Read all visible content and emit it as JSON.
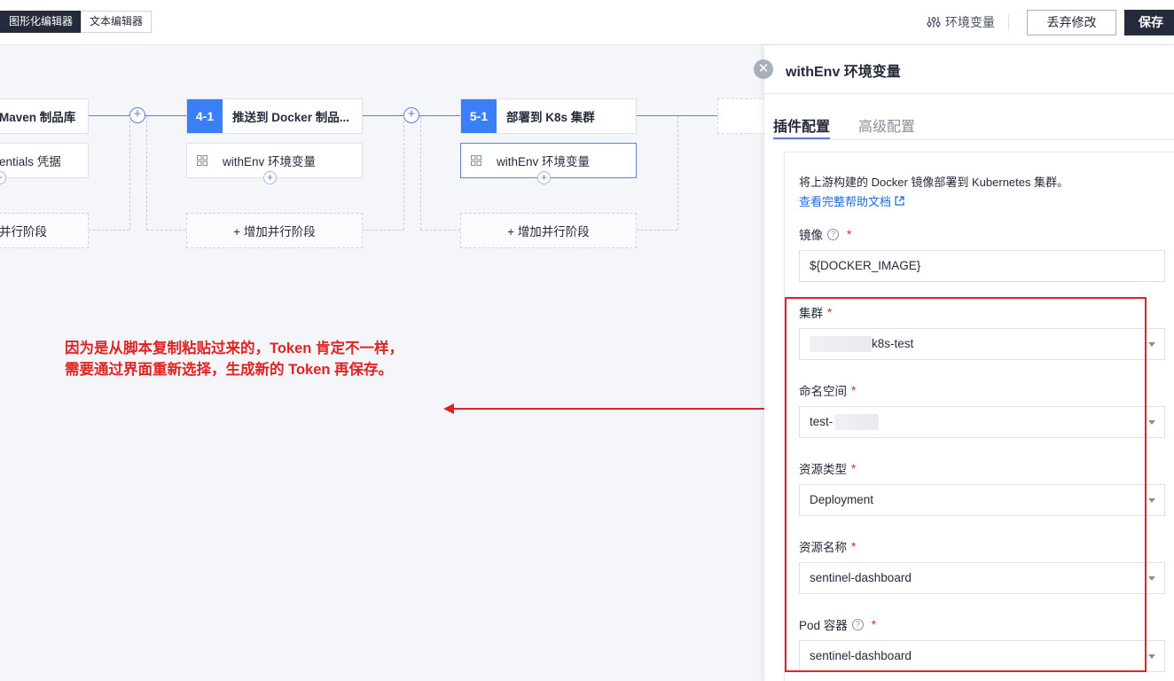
{
  "topbar": {
    "mode_tabs": [
      {
        "label": "图形化编辑器",
        "active": true
      },
      {
        "label": "文本编辑器",
        "active": false
      }
    ],
    "env_label": "环境变量",
    "discard_label": "丢弃修改",
    "save_label": "保存"
  },
  "canvas": {
    "stages": [
      {
        "num": "",
        "name": "Maven 制品库"
      },
      {
        "num": "4-1",
        "name": "推送到 Docker 制品..."
      },
      {
        "num": "5-1",
        "name": "部署到 K8s 集群"
      }
    ],
    "jobs": [
      {
        "label": "entials 凭据"
      },
      {
        "label": "withEnv 环境变量"
      },
      {
        "label": "withEnv 环境变量"
      }
    ],
    "parallel_label_partial": "并行阶段",
    "parallel_label": "+ 增加并行阶段"
  },
  "annotation": {
    "line1": "因为是从脚本复制粘贴过来的，Token 肯定不一样，",
    "line2": "需要通过界面重新选择，生成新的 Token 再保存。"
  },
  "panel": {
    "title": "withEnv 环境变量",
    "tabs": [
      "插件配置",
      "高级配置"
    ],
    "description": "将上游构建的 Docker 镜像部署到 Kubernetes 集群。",
    "help_link": "查看完整帮助文档",
    "fields": {
      "image": {
        "label": "镜像",
        "value": "${DOCKER_IMAGE}"
      },
      "cluster": {
        "label": "集群",
        "value": "k8s-test"
      },
      "namespace": {
        "label": "命名空间",
        "value": "test-"
      },
      "resource_type": {
        "label": "资源类型",
        "value": "Deployment"
      },
      "resource_name": {
        "label": "资源名称",
        "value": "sentinel-dashboard"
      },
      "pod_container": {
        "label": "Pod 容器",
        "value": "sentinel-dashboard"
      }
    },
    "required_mark": "*"
  },
  "colors": {
    "accent": "#5e7ce0",
    "stage_blue": "#3b7ff6",
    "annotation_red": "#e02424",
    "dark": "#252b3a"
  }
}
